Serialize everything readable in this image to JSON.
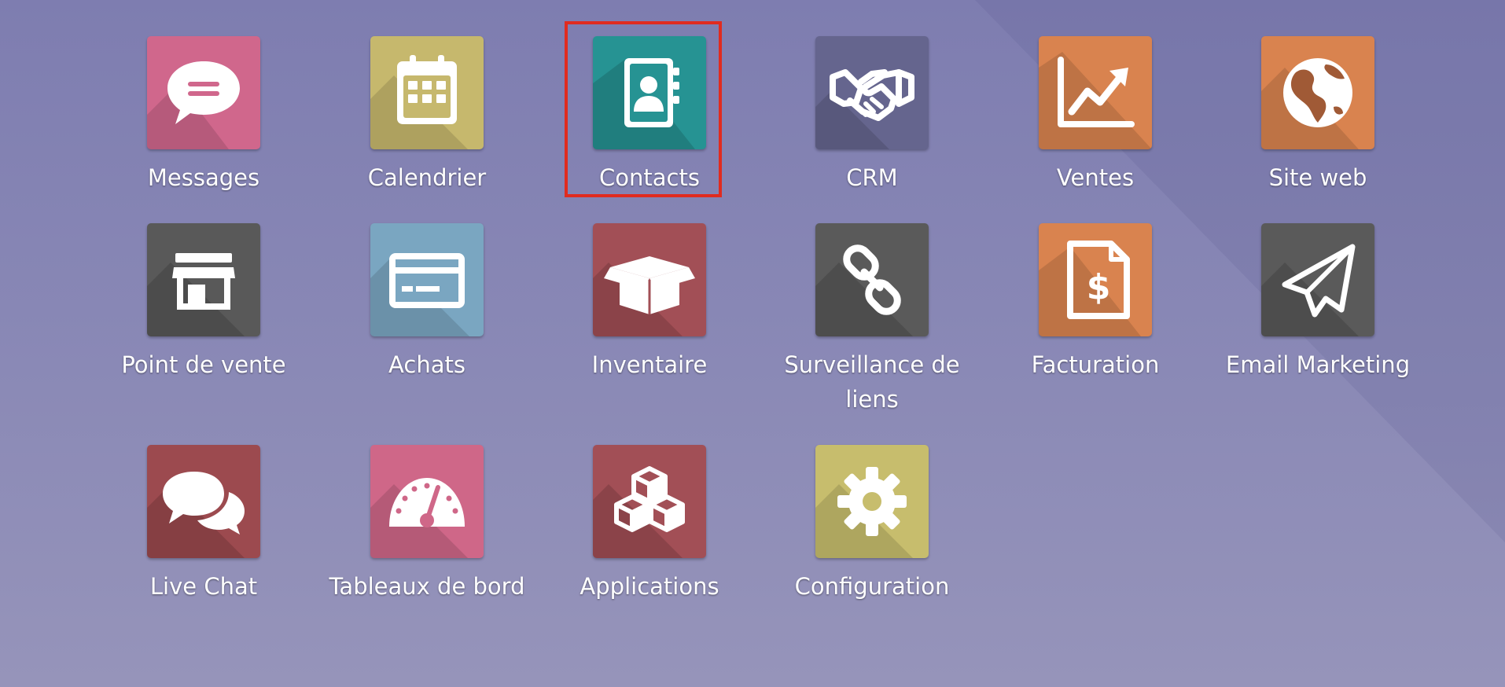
{
  "apps": [
    {
      "id": "messages",
      "label": "Messages",
      "icon": "chat-bubble-icon",
      "color": "#d0678c",
      "selected": false
    },
    {
      "id": "calendar",
      "label": "Calendrier",
      "icon": "calendar-icon",
      "color": "#c6b86d",
      "selected": false
    },
    {
      "id": "contacts",
      "label": "Contacts",
      "icon": "address-book-icon",
      "color": "#269393",
      "selected": true
    },
    {
      "id": "crm",
      "label": "CRM",
      "icon": "handshake-icon",
      "color": "#65658e",
      "selected": false
    },
    {
      "id": "sales",
      "label": "Ventes",
      "icon": "chart-line-icon",
      "color": "#d9834f",
      "selected": false
    },
    {
      "id": "website",
      "label": "Site web",
      "icon": "globe-icon",
      "color": "#d9834f",
      "selected": false
    },
    {
      "id": "pos",
      "label": "Point de vente",
      "icon": "store-icon",
      "color": "#595959",
      "selected": false
    },
    {
      "id": "purchase",
      "label": "Achats",
      "icon": "credit-card-icon",
      "color": "#7aa6c1",
      "selected": false
    },
    {
      "id": "inventory",
      "label": "Inventaire",
      "icon": "open-box-icon",
      "color": "#a24f56",
      "selected": false
    },
    {
      "id": "link-tracker",
      "label": "Surveillance de liens",
      "icon": "chain-link-icon",
      "color": "#5a5a5a",
      "selected": false
    },
    {
      "id": "invoicing",
      "label": "Facturation",
      "icon": "invoice-dollar-icon",
      "color": "#d9834f",
      "selected": false
    },
    {
      "id": "email-marketing",
      "label": "Email Marketing",
      "icon": "paper-plane-icon",
      "color": "#5a5a5a",
      "selected": false
    },
    {
      "id": "live-chat",
      "label": "Live Chat",
      "icon": "chat-bubbles-icon",
      "color": "#9c4a4f",
      "selected": false
    },
    {
      "id": "dashboards",
      "label": "Tableaux de bord",
      "icon": "dashboard-gauge-icon",
      "color": "#cf6788",
      "selected": false
    },
    {
      "id": "apps",
      "label": "Applications",
      "icon": "cubes-icon",
      "color": "#a24f56",
      "selected": false
    },
    {
      "id": "settings",
      "label": "Configuration",
      "icon": "gear-icon",
      "color": "#c7bd6d",
      "selected": false
    }
  ],
  "colors": {
    "background": "#8584b4",
    "selection_frame": "#e02b1f",
    "label_text": "#ffffff"
  }
}
